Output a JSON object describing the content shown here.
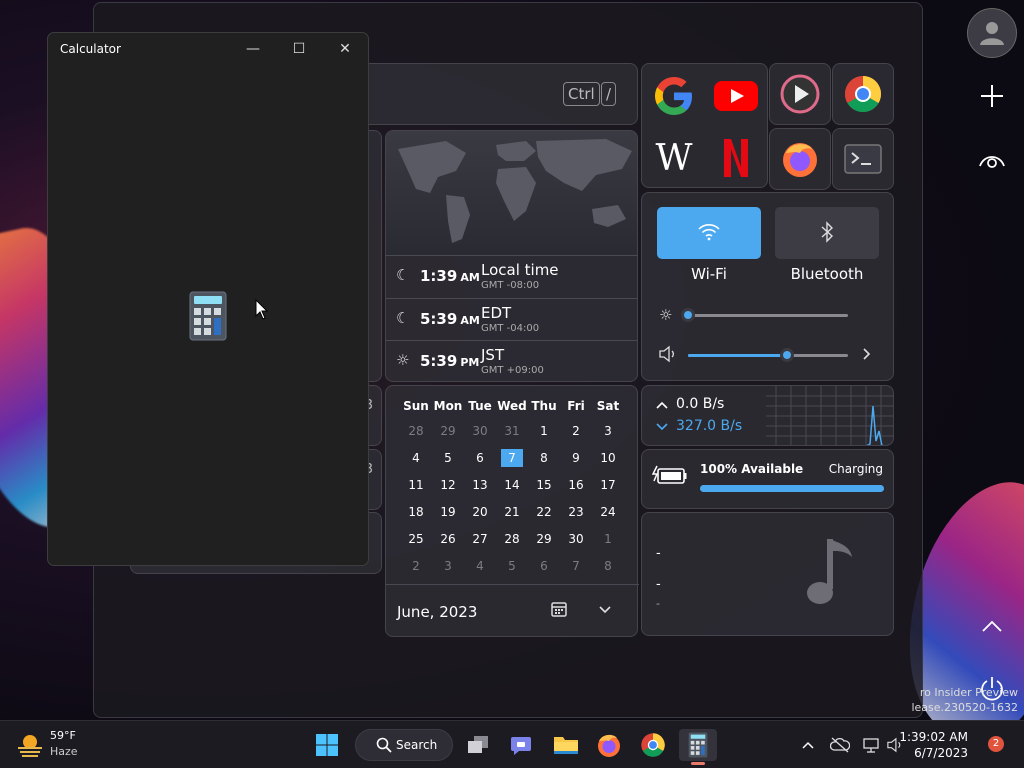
{
  "calculator": {
    "title": "Calculator",
    "minimize_glyph": "—",
    "maximize_glyph": "☐",
    "close_glyph": "✕"
  },
  "search": {
    "shortcut_key1": "Ctrl",
    "shortcut_key2": "/"
  },
  "world_clock": {
    "entries": [
      {
        "icon": "moon-icon",
        "time": "1:39",
        "ampm": "AM",
        "zone": "Local time",
        "gmt": "GMT -08:00"
      },
      {
        "icon": "moon-icon",
        "time": "5:39",
        "ampm": "AM",
        "zone": "EDT",
        "gmt": "GMT -04:00"
      },
      {
        "icon": "sun-icon",
        "time": "5:39",
        "ampm": "PM",
        "zone": "JST",
        "gmt": "GMT +09:00"
      }
    ]
  },
  "calendar": {
    "weekdays": [
      "Sun",
      "Mon",
      "Tue",
      "Wed",
      "Thu",
      "Fri",
      "Sat"
    ],
    "weeks": [
      [
        "28",
        "29",
        "30",
        "31",
        "1",
        "2",
        "3"
      ],
      [
        "4",
        "5",
        "6",
        "7",
        "8",
        "9",
        "10"
      ],
      [
        "11",
        "12",
        "13",
        "14",
        "15",
        "16",
        "17"
      ],
      [
        "18",
        "19",
        "20",
        "21",
        "22",
        "23",
        "24"
      ],
      [
        "25",
        "26",
        "27",
        "28",
        "29",
        "30",
        "1"
      ],
      [
        "2",
        "3",
        "4",
        "5",
        "6",
        "7",
        "8"
      ]
    ],
    "today": "7",
    "month_label": "June, 2023"
  },
  "quick_settings": {
    "wifi_label": "Wi-Fi",
    "bluetooth_label": "Bluetooth",
    "brightness_level": 0,
    "volume_level": 0.62
  },
  "network": {
    "upload": "0.0 B/s",
    "download": "327.0 B/s"
  },
  "battery": {
    "status": "100% Available",
    "charging": "Charging",
    "level": 1.0
  },
  "music": {
    "line1": "-",
    "line2": "-",
    "line3": "-"
  },
  "weather": {
    "temp": "59°F",
    "condition": "Haze"
  },
  "taskbar": {
    "search_label": "Search",
    "time": "1:39:02 AM",
    "date": "6/7/2023",
    "notification_count": "2"
  },
  "watermark": {
    "line1": "ro Insider Preview",
    "line2": "lease.230520-1632"
  },
  "colors": {
    "accent": "#4ca8ef",
    "wifi_tile": "#4ca8ef"
  }
}
